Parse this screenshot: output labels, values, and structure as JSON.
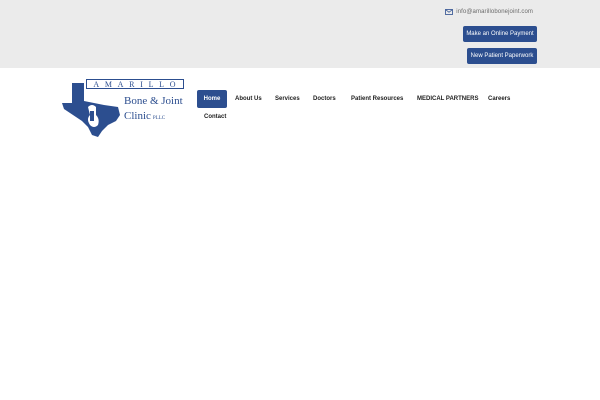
{
  "header": {
    "email": "info@amarillobonejoint.com",
    "email_icon": "envelope-icon",
    "buttons": {
      "payment": "Make an Online Payment",
      "paperwork": "New Patient Paperwork"
    }
  },
  "logo": {
    "letters": [
      "A",
      "M",
      "A",
      "R",
      "I",
      "L",
      "L",
      "O"
    ],
    "line1": "Bone & Joint",
    "line2": "Clinic",
    "line2_suffix": "PLLC",
    "icon": "texas-map-bone-icon"
  },
  "nav": {
    "items": [
      "Home",
      "About Us",
      "Services",
      "Doctors",
      "Patient Resources",
      "MEDICAL PARTNERS",
      "Careers",
      "Contact"
    ],
    "active": "Home"
  },
  "colors": {
    "brand": "#2c4e8f",
    "topbar_bg": "#ebebeb"
  }
}
